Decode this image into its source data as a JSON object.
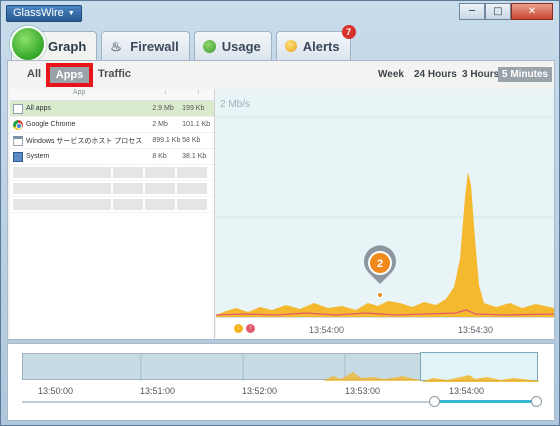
{
  "app": {
    "title": "GlassWire"
  },
  "window_controls": {
    "minimize": "─",
    "maximize": "□",
    "close": "✕"
  },
  "tabs": [
    {
      "label": "Graph",
      "icon": "glasswire-logo-icon",
      "active": true
    },
    {
      "label": "Firewall",
      "icon": "fire-icon"
    },
    {
      "label": "Usage",
      "icon": "usage-icon"
    },
    {
      "label": "Alerts",
      "icon": "alert-icon",
      "badge": "7"
    }
  ],
  "subnav": {
    "all": "All",
    "apps": "Apps",
    "traffic": "Traffic"
  },
  "ranges": [
    "Week",
    "24 Hours",
    "3 Hours",
    "5 Minutes"
  ],
  "active_range": "5 Minutes",
  "app_list": {
    "headers": {
      "app": "App",
      "down": "↓",
      "up": "↑"
    },
    "rows": [
      {
        "name": "All apps",
        "icon": "all-apps-icon",
        "down": "2.9 Mb",
        "up": "199 Kb",
        "selected": true
      },
      {
        "name": "Google Chrome",
        "icon": "chrome-icon",
        "down": "2 Mb",
        "up": "101.1 Kb"
      },
      {
        "name": "Windows サービスのホスト プロセス",
        "icon": "windows-service-icon",
        "down": "899.1 Kb",
        "up": "58 Kb"
      },
      {
        "name": "System",
        "icon": "system-icon",
        "down": "8 Kb",
        "up": "38.1 Kb"
      }
    ]
  },
  "graph": {
    "scale_label": "2 Mb/s",
    "event_marker": "2",
    "time_labels": [
      "13:54:00",
      "13:54:30"
    ],
    "legend_dots": {
      "down": "↓",
      "up": "↑"
    },
    "colors": {
      "download": "#f6b21a",
      "upload": "#e25a6b",
      "background": "#e8f4f6"
    }
  },
  "timeline": {
    "labels": [
      "13:50:00",
      "13:51:00",
      "13:52:00",
      "13:53:00",
      "13:54:00"
    ],
    "selection_color": "#38b7d5"
  }
}
